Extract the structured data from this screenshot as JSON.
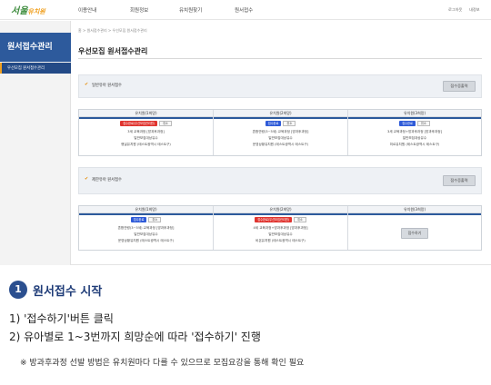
{
  "header": {
    "logo_text": "서울",
    "logo_sub": "유치원",
    "nav": [
      "이용안내",
      "회원정보",
      "유치원찾기",
      "원서접수"
    ],
    "util": [
      "로그아웃",
      "내정보"
    ]
  },
  "sidebar": {
    "title": "원서접수관리",
    "items": [
      {
        "label": "우선모집 원서접수관리"
      }
    ]
  },
  "breadcrumb": "홈 > 원서접수관리 > 우선모집 원서접수관리",
  "page_title": "우선모집 원서접수관리",
  "panel1": {
    "label": "일반유아 원서접수",
    "button": "접수증출력"
  },
  "table1": {
    "columns": [
      {
        "header": "유치원(1희망)",
        "badge": "접수완료(우선모집관리원)",
        "badge_color": "red",
        "mini": "취소",
        "lines": [
          "3세 교육과정 [방과후과정]",
          "일반보집대상유수",
          "햇살유치원 (테스트광역시 테스트구)"
        ]
      },
      {
        "header": "유치원(2희망)",
        "badge": "접수완료",
        "badge_color": "blue",
        "mini": "취소",
        "lines": [
          "혼합연령(3~5세) 교육과정 [방과후과정]",
          "일반보집대상유수",
          "운영상황유치원 (테스트광역시 테스트구)"
        ]
      },
      {
        "header": "유치원(3희망)",
        "badge": "접수완료",
        "badge_color": "blue",
        "mini": "취소",
        "lines": [
          "3세 교육과정+방과후과정 [방과후과정]",
          "일반보집대상유수",
          "미르유치원 (테스트광역시 테스트구)"
        ]
      }
    ]
  },
  "panel2": {
    "label": "제한유아 원서접수",
    "button": "접수증출력"
  },
  "table2": {
    "columns": [
      {
        "header": "유치원(1희망)",
        "badge": "접수완료",
        "badge_color": "blue",
        "mini": "취소",
        "lines": [
          "혼합연령(3~5세) 교육과정 [방과후과정]",
          "일반보집대상유수",
          "운영상황유치원 (테스트광역시 테스트구)"
        ]
      },
      {
        "header": "유치원(2희망)",
        "badge": "접수완료(우선모집관리원)",
        "badge_color": "red",
        "mini": "취소",
        "lines": [
          "4세 교육과정+방과후과정 [방과후과정]",
          "일반보집대상유수",
          "비온유치원 (테스트광역시 테스트구)"
        ]
      },
      {
        "header": "유치원(3희망)",
        "button": "접수하기"
      }
    ]
  },
  "instructions": {
    "step_number": "1",
    "step_title": "원서접수 시작",
    "items": [
      "1) '접수하기'버튼 클릭",
      "2) 유아별로 1~3번까지 희망순에 따라 '접수하기' 진행"
    ],
    "note": "※ 방과후과정 선발 방법은 유치원마다 다를 수 있으므로 모집요강을 통해 확인 필요"
  }
}
